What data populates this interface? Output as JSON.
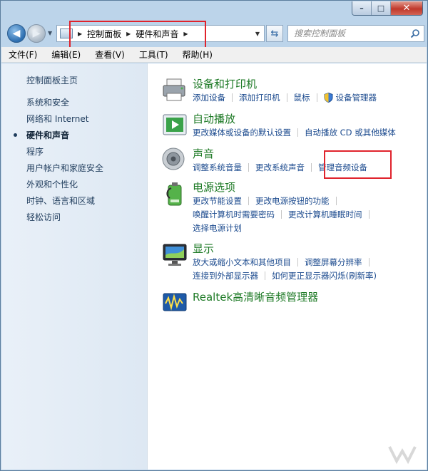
{
  "window": {
    "controls": {
      "minimize": "–",
      "maximize": "□",
      "close": "✕"
    }
  },
  "nav": {
    "address_crumbs": [
      "控制面板",
      "硬件和声音"
    ],
    "search_placeholder": "搜索控制面板"
  },
  "menu": [
    "文件(F)",
    "编辑(E)",
    "查看(V)",
    "工具(T)",
    "帮助(H)"
  ],
  "sidebar": {
    "home": "控制面板主页",
    "items": [
      {
        "label": "系统和安全",
        "current": false
      },
      {
        "label": "网络和 Internet",
        "current": false
      },
      {
        "label": "硬件和声音",
        "current": true
      },
      {
        "label": "程序",
        "current": false
      },
      {
        "label": "用户帐户和家庭安全",
        "current": false
      },
      {
        "label": "外观和个性化",
        "current": false
      },
      {
        "label": "时钟、语言和区域",
        "current": false
      },
      {
        "label": "轻松访问",
        "current": false
      }
    ]
  },
  "categories": [
    {
      "title": "设备和打印机",
      "icon": "printer-icon",
      "rows": [
        [
          "添加设备",
          "添加打印机",
          "鼠标",
          "设备管理器"
        ]
      ]
    },
    {
      "title": "自动播放",
      "icon": "autoplay-icon",
      "rows": [
        [
          "更改媒体或设备的默认设置",
          "自动播放 CD 或其他媒体"
        ]
      ]
    },
    {
      "title": "声音",
      "icon": "speaker-icon",
      "rows": [
        [
          "调整系统音量",
          "更改系统声音",
          "管理音频设备"
        ]
      ]
    },
    {
      "title": "电源选项",
      "icon": "power-icon",
      "rows": [
        [
          "更改节能设置",
          "更改电源按钮的功能"
        ],
        [
          "唤醒计算机时需要密码",
          "更改计算机睡眠时间"
        ],
        [
          "选择电源计划"
        ]
      ]
    },
    {
      "title": "显示",
      "icon": "display-icon",
      "rows": [
        [
          "放大或缩小文本和其他项目",
          "调整屏幕分辨率"
        ],
        [
          "连接到外部显示器",
          "如何更正显示器闪烁(刷新率)"
        ]
      ]
    },
    {
      "title": "Realtek高清晰音频管理器",
      "icon": "realtek-audio-icon",
      "rows": []
    }
  ],
  "colors": {
    "category_title": "#1e7a26",
    "link": "#1b4a8e",
    "highlight_box": "#e0232c",
    "sidebar_bg": "#e9f0f8"
  }
}
